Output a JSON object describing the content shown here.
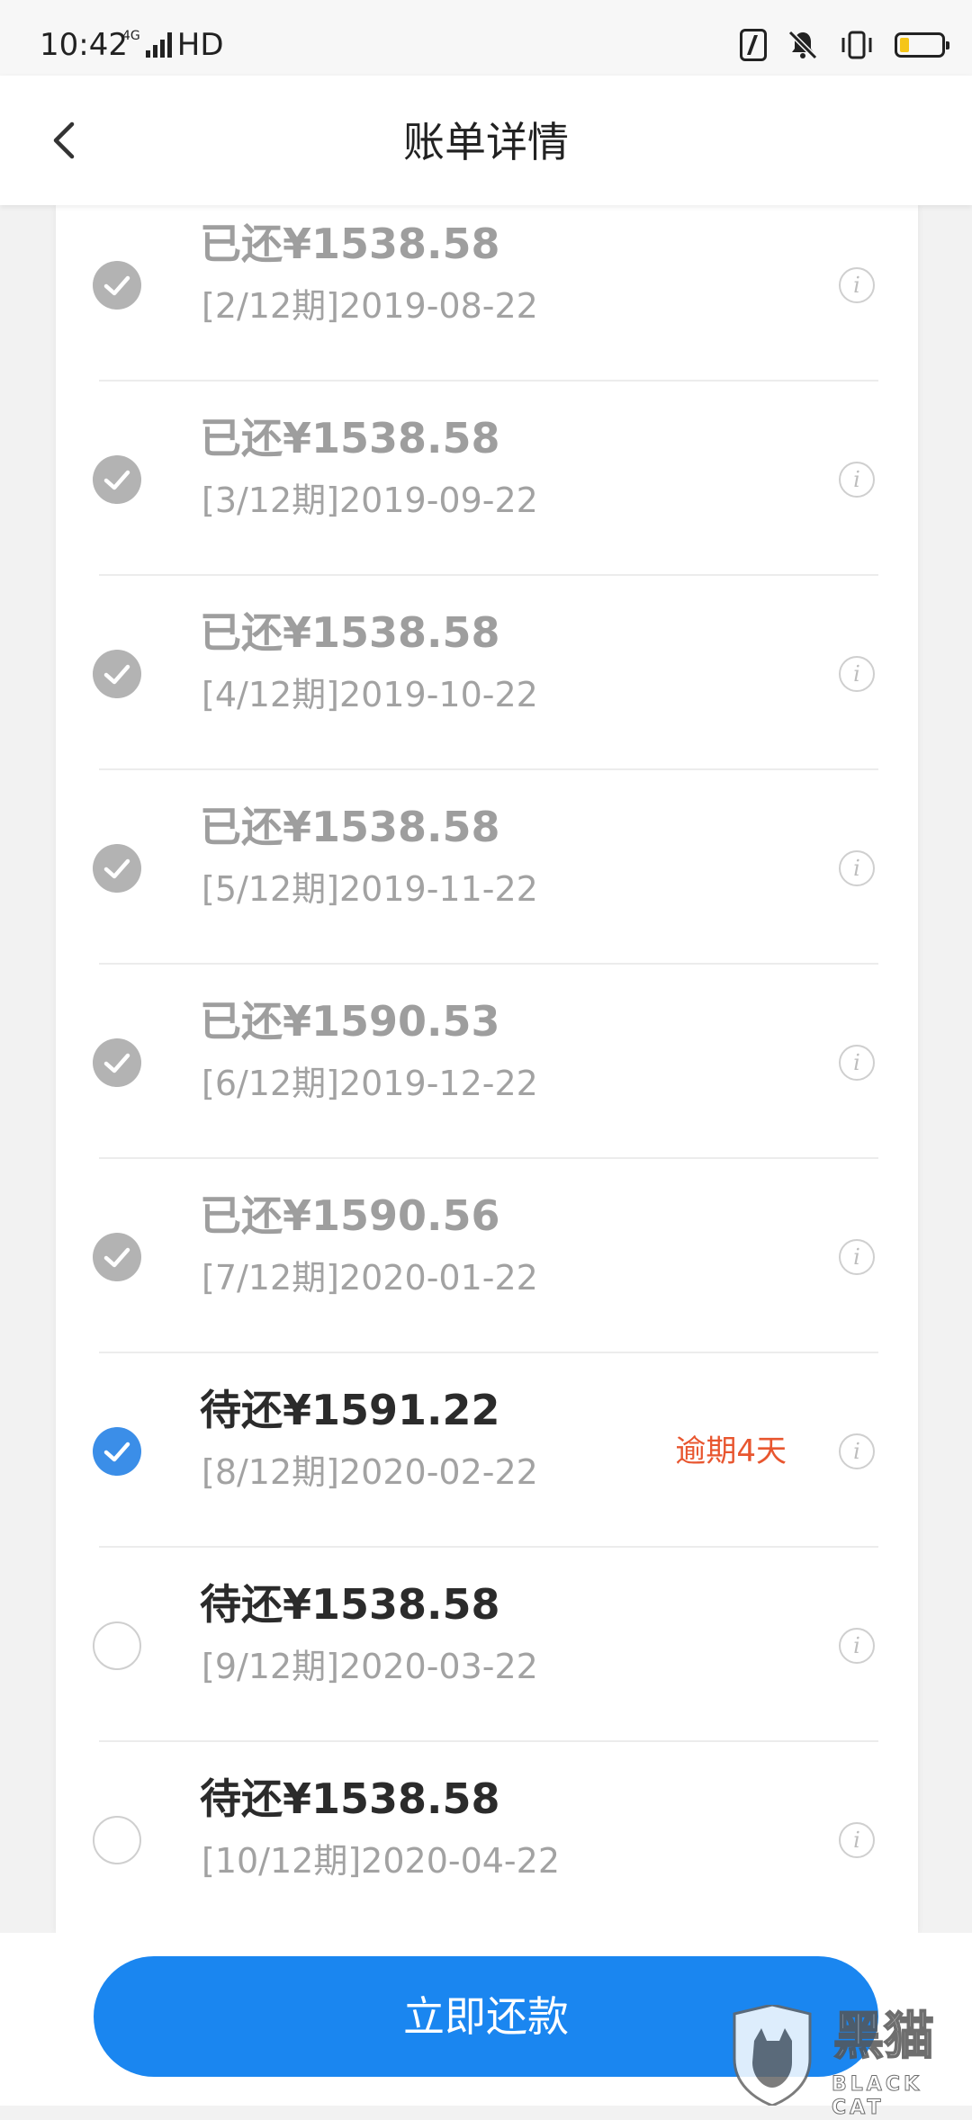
{
  "status_bar": {
    "time": "10:42",
    "network_small": "4G",
    "network_hd": "HD"
  },
  "header": {
    "title": "账单详情"
  },
  "installments": [
    {
      "amount": "已还¥1538.58",
      "period": "[2/12期]2019-08-22",
      "state": "paid",
      "overdue": ""
    },
    {
      "amount": "已还¥1538.58",
      "period": "[3/12期]2019-09-22",
      "state": "paid",
      "overdue": ""
    },
    {
      "amount": "已还¥1538.58",
      "period": "[4/12期]2019-10-22",
      "state": "paid",
      "overdue": ""
    },
    {
      "amount": "已还¥1538.58",
      "period": "[5/12期]2019-11-22",
      "state": "paid",
      "overdue": ""
    },
    {
      "amount": "已还¥1590.53",
      "period": "[6/12期]2019-12-22",
      "state": "paid",
      "overdue": ""
    },
    {
      "amount": "已还¥1590.56",
      "period": "[7/12期]2020-01-22",
      "state": "paid",
      "overdue": ""
    },
    {
      "amount": "待还¥1591.22",
      "period": "[8/12期]2020-02-22",
      "state": "selected",
      "overdue": "逾期4天"
    },
    {
      "amount": "待还¥1538.58",
      "period": "[9/12期]2020-03-22",
      "state": "unpaid",
      "overdue": ""
    },
    {
      "amount": "待还¥1538.58",
      "period": "[10/12期]2020-04-22",
      "state": "unpaid",
      "overdue": ""
    }
  ],
  "footer": {
    "pay_label": "立即还款"
  },
  "watermark": {
    "name": "黑猫",
    "sub": "BLACK CAT"
  },
  "colors": {
    "accent": "#1a86f0",
    "selected_check": "#3b8ee8",
    "paid_check": "#b3b3b3",
    "overdue": "#e8562f"
  }
}
